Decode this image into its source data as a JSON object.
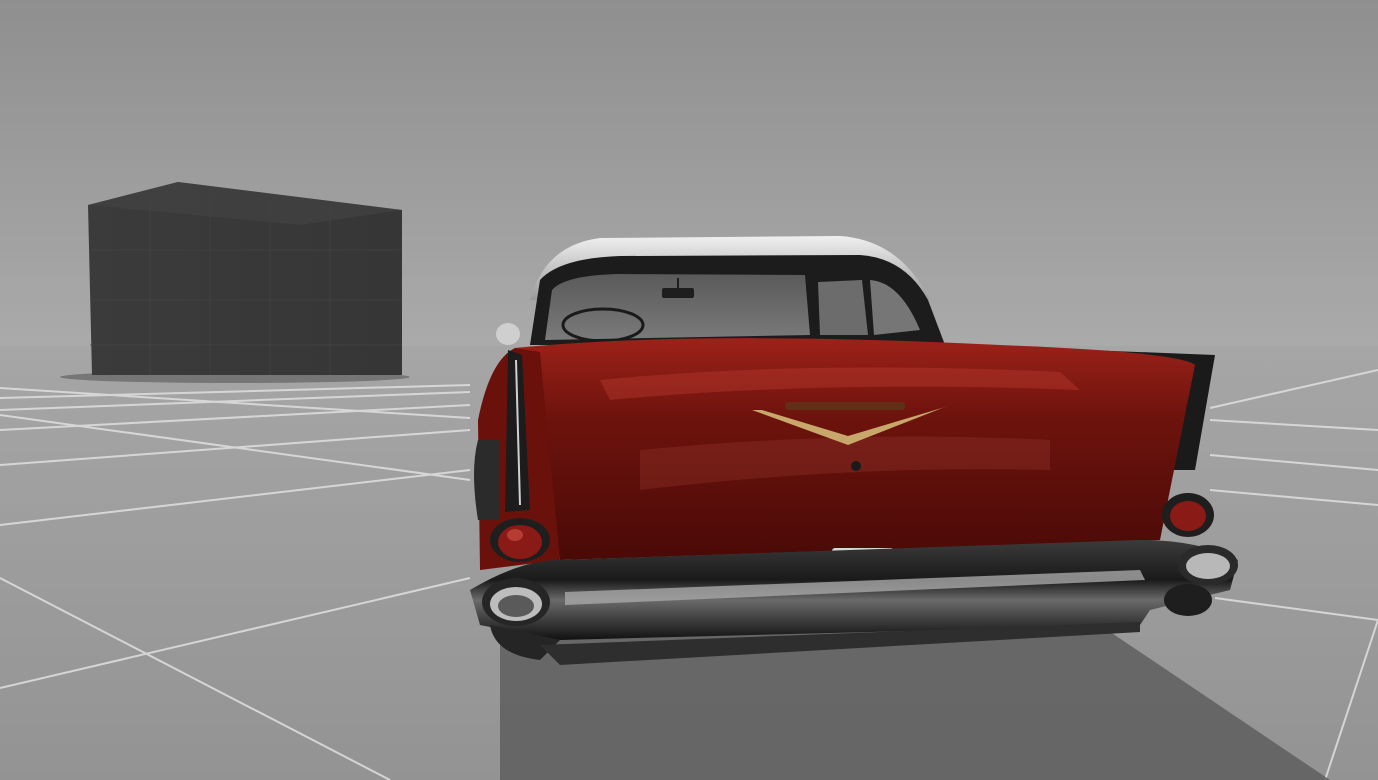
{
  "scene": {
    "sky_top_color": "#8e8e8e",
    "sky_horizon_color": "#a9a9a9",
    "floor_color": "#9c9c9c",
    "grid_line_color": "#d9d9d9",
    "box_color": "#3a3a3a",
    "car_body_color": "#7a1410",
    "car_roof_color": "#d6d6d6",
    "chrome_color": "#2a2a2a"
  }
}
